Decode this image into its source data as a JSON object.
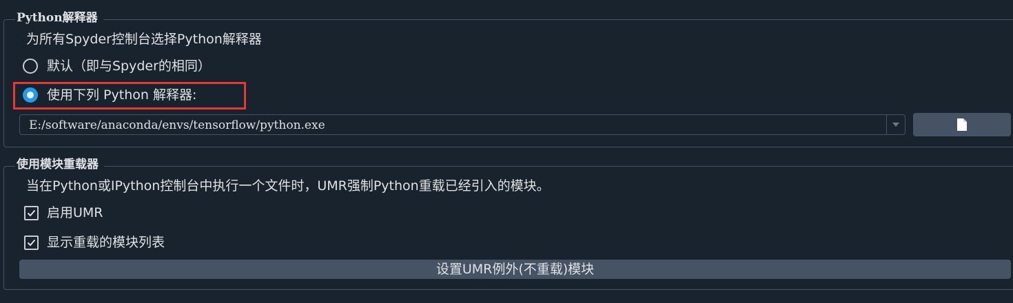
{
  "python_interpreter": {
    "title": "Python解释器",
    "description": "为所有Spyder控制台选择Python解释器",
    "radio_default_label": "默认（即与Spyder的相同）",
    "radio_custom_label": "使用下列 Python 解释器:",
    "selected_option": "custom",
    "interpreter_path": "E:/software/anaconda/envs/tensorflow/python.exe",
    "file_button_icon": "file-icon"
  },
  "umr": {
    "title": "使用模块重载器",
    "description": "当在Python或IPython控制台中执行一个文件时，UMR强制Python重载已经引入的模块。",
    "enable_label": "启用UMR",
    "enable_checked": true,
    "show_list_label": "显示重载的模块列表",
    "show_list_checked": true,
    "exclude_button_label": "设置UMR例外(不重载)模块"
  },
  "colors": {
    "background": "#19232d",
    "border": "#455364",
    "accent": "#259ae9",
    "highlight": "#e53935",
    "button": "#455364"
  }
}
